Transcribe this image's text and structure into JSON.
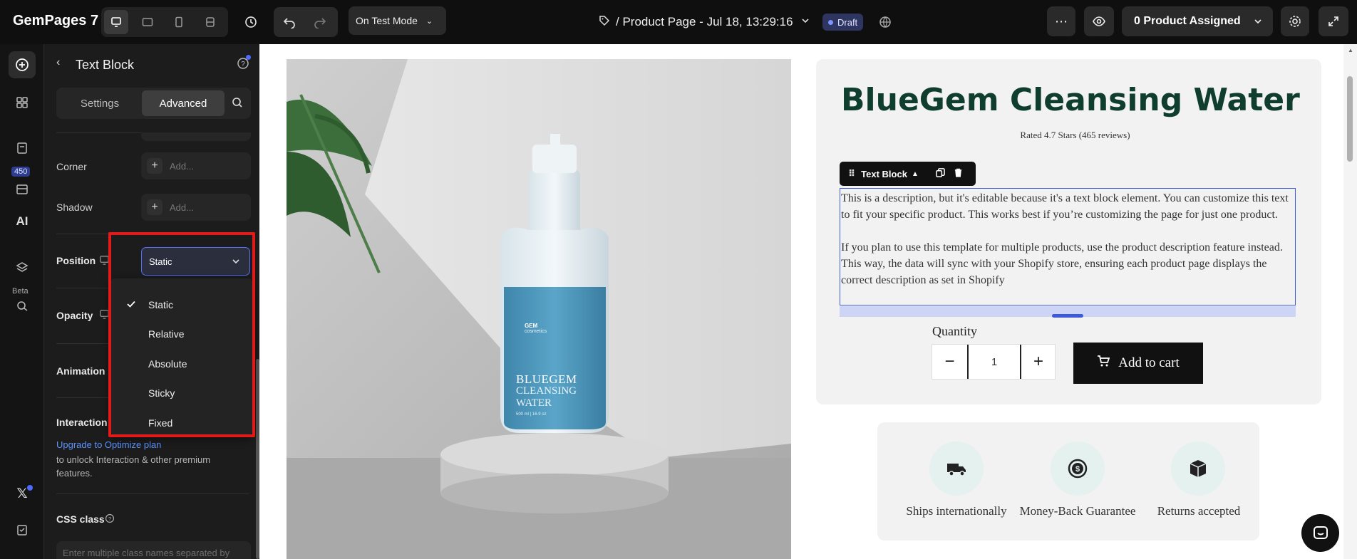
{
  "app": {
    "logo": "GemPages 7",
    "test_mode": "On Test Mode",
    "page_title": "/ Product Page - Jul 18, 13:29:16",
    "draft": "Draft",
    "product_assigned": "0 Product Assigned"
  },
  "rail": {
    "badge_450": "450",
    "beta": "Beta"
  },
  "panel": {
    "title": "Text Block",
    "tab_settings": "Settings",
    "tab_advanced": "Advanced",
    "corner_label": "Corner",
    "shadow_label": "Shadow",
    "add_placeholder": "Add...",
    "position_label": "Position",
    "position_value": "Static",
    "opacity_label": "Opacity",
    "animation_label": "Animation",
    "interaction_label": "Interaction",
    "upgrade_link": "Upgrade to Optimize plan",
    "upgrade_text": "to unlock Interaction & other premium features.",
    "css_class_label": "CSS class",
    "css_placeholder": "Enter multiple class names separated by"
  },
  "dropdown": {
    "options": [
      "Static",
      "Relative",
      "Absolute",
      "Sticky",
      "Fixed"
    ],
    "selected": "Static"
  },
  "product": {
    "title": "BlueGem Cleansing Water",
    "rating": "Rated 4.7 Stars (465 reviews)",
    "toolbar_label": "Text Block",
    "desc1": "This is a description, but it's editable because it's a text block element. You can customize this text to fit your specific product. This works best if you’re customizing the page for just one product.",
    "desc2": "If you plan to use this template for multiple products, use the product description feature instead. This way, the data will sync with your Shopify store, ensuring each product page displays the correct description as set in Shopify",
    "quantity_label": "Quantity",
    "quantity_value": "1",
    "add_to_cart": "Add to cart",
    "bottle_brand": "GEM",
    "bottle_sub": "cosmetics",
    "bottle_l1": "BLUEGEM",
    "bottle_l2": "CLEANSING",
    "bottle_l3": "WATER",
    "bottle_small": "500 ml | 16.9 oz"
  },
  "features": [
    {
      "label": "Ships internationally",
      "icon": "truck-icon"
    },
    {
      "label": "Money-Back Guarantee",
      "icon": "money-back-icon"
    },
    {
      "label": "Returns accepted",
      "icon": "box-icon"
    }
  ],
  "colors": {
    "accent": "#3b5bdb",
    "title_green": "#0f3d2e",
    "red_highlight": "#e31a1a",
    "link_blue": "#4f8cff"
  }
}
